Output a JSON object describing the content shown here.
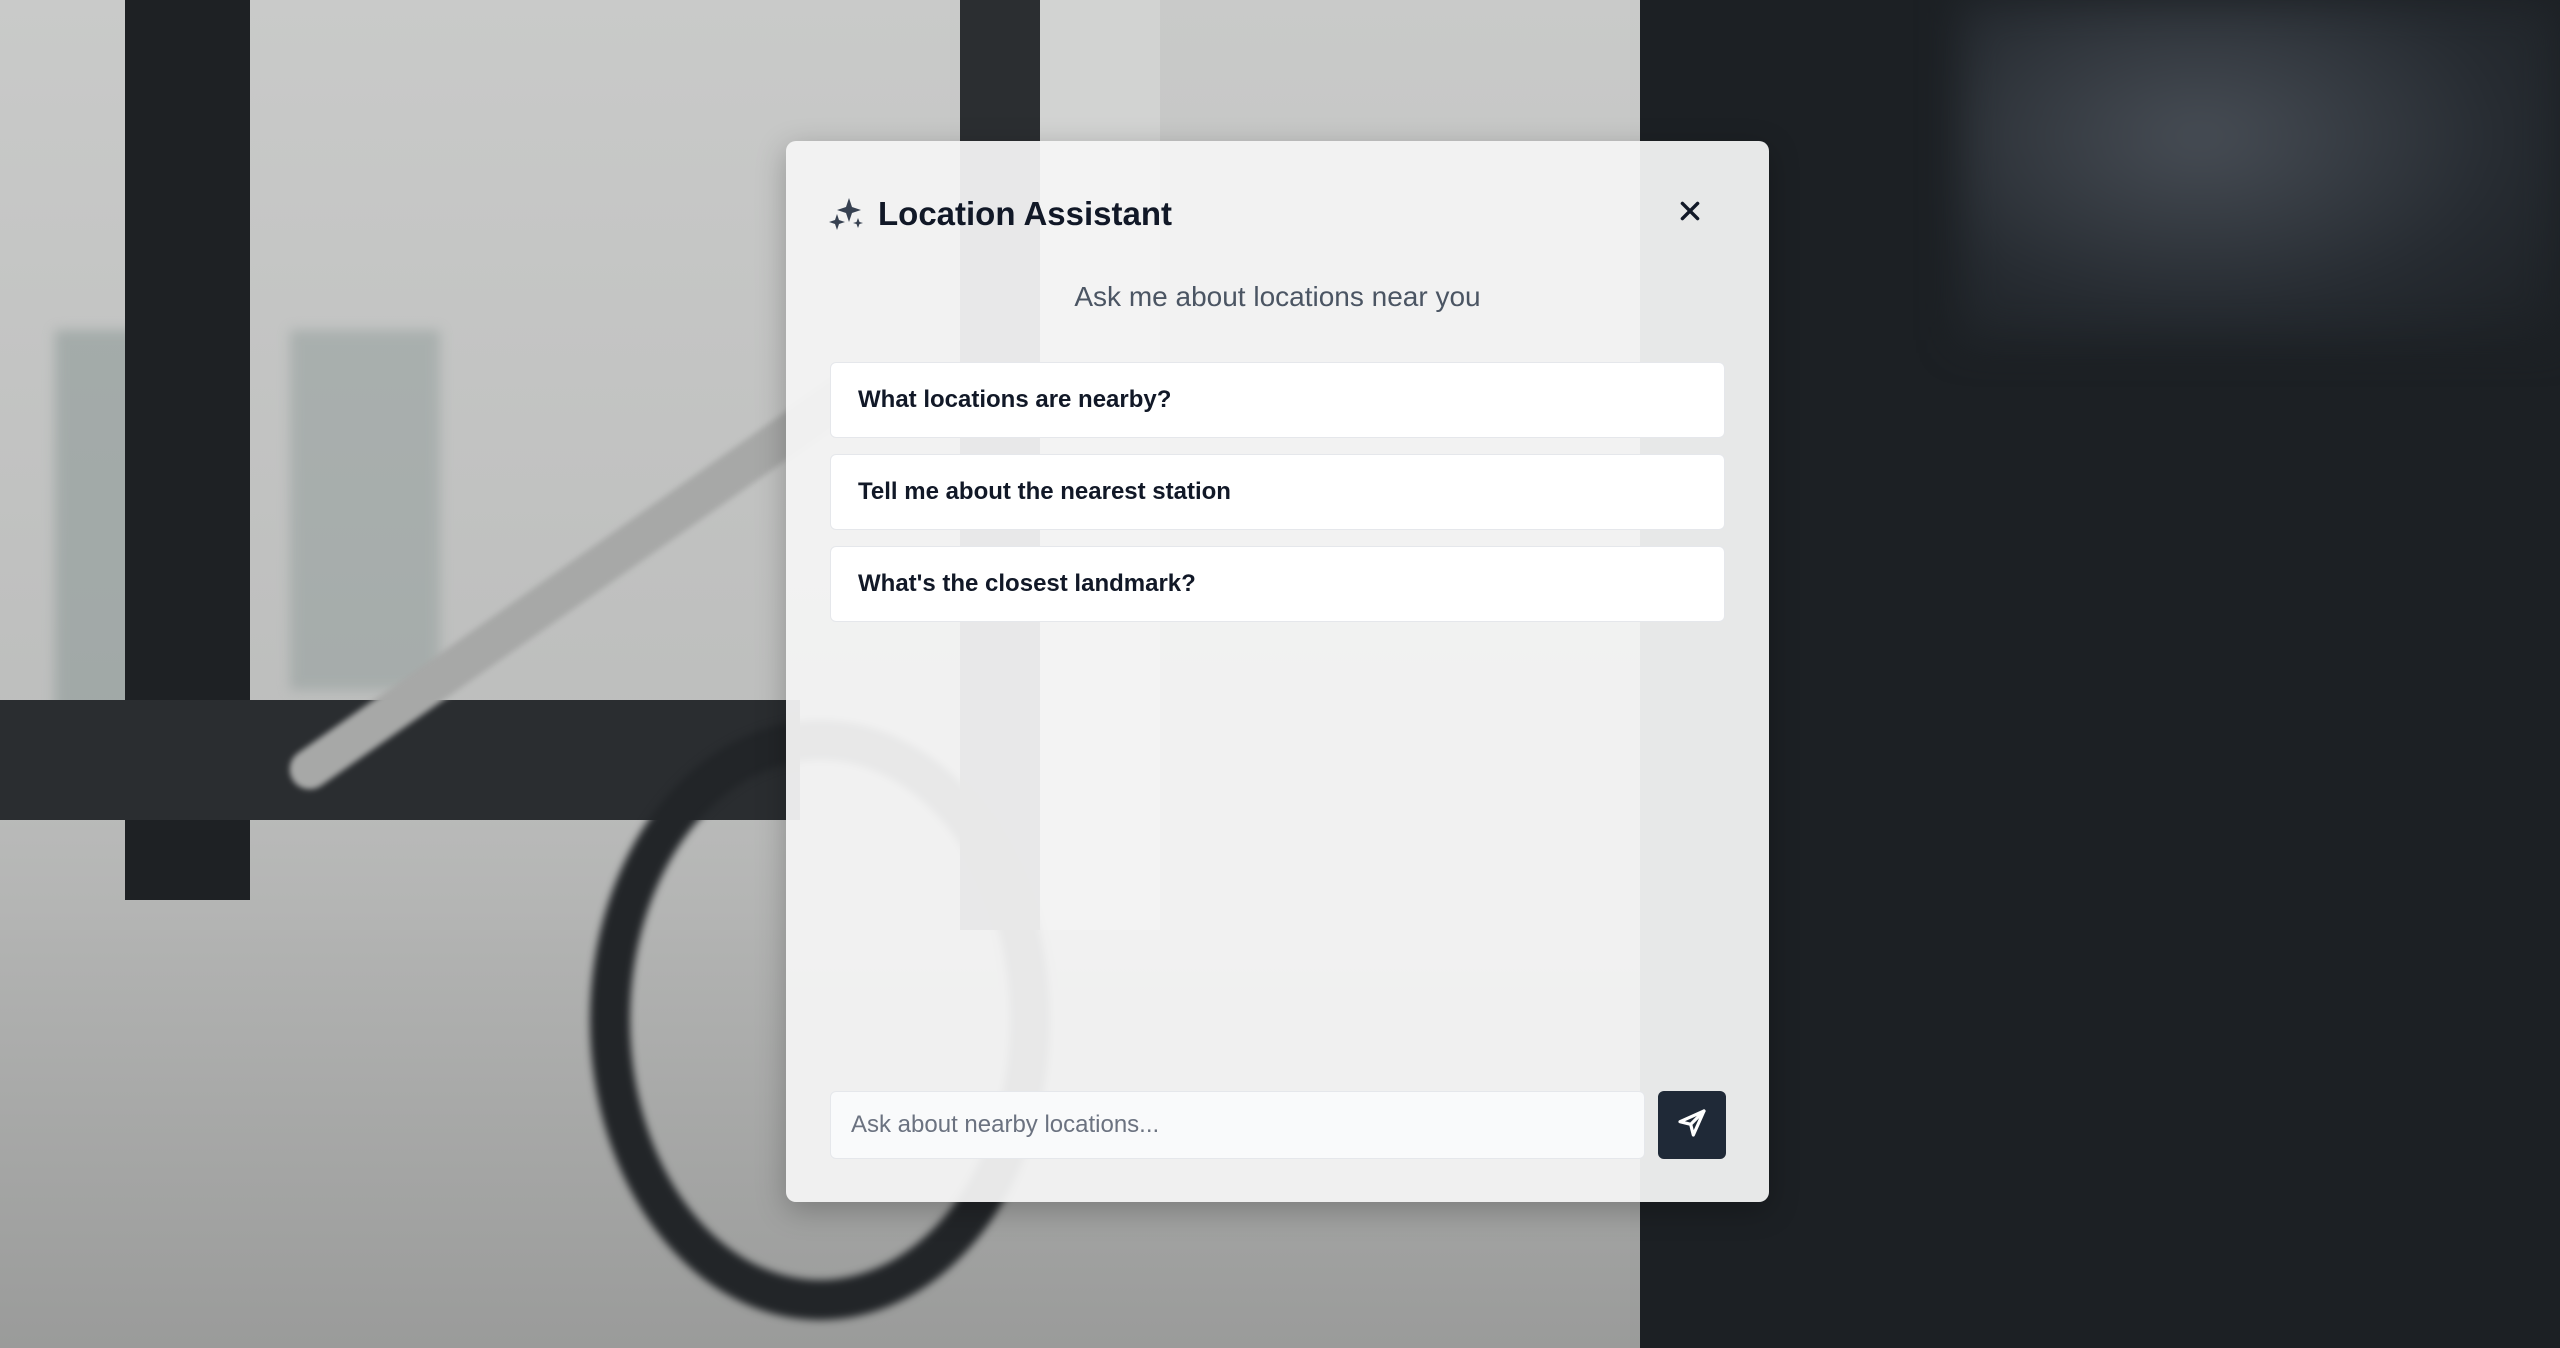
{
  "dialog": {
    "title": "Location Assistant",
    "logo_icon": "sparkle-icon",
    "close_icon": "close-icon",
    "subtitle": "Ask me about locations near you"
  },
  "suggestions": [
    {
      "label": "What locations are nearby?"
    },
    {
      "label": "Tell me about the nearest station"
    },
    {
      "label": "What's the closest landmark?"
    }
  ],
  "composer": {
    "placeholder": "Ask about nearby locations...",
    "value": "",
    "send_icon": "send-icon"
  },
  "colors": {
    "title_text": "#111827",
    "subtitle_text": "#4b5563",
    "send_button_bg": "#1f2937",
    "dialog_bg": "#f4f4f4"
  }
}
